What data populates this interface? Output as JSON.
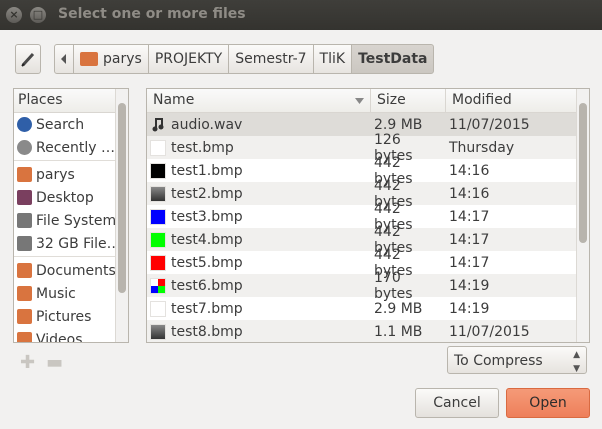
{
  "window": {
    "title": "Select one or more files"
  },
  "breadcrumbs": [
    "parys",
    "PROJEKTY",
    "Semestr-7",
    "TliK",
    "TestData"
  ],
  "places": {
    "header": "Places",
    "items": [
      {
        "label": "Search",
        "icon": "search-icon"
      },
      {
        "label": "Recently …",
        "icon": "recent-icon"
      },
      {
        "label": "parys",
        "icon": "home-folder-icon"
      },
      {
        "label": "Desktop",
        "icon": "desktop-icon"
      },
      {
        "label": "File System",
        "icon": "drive-icon"
      },
      {
        "label": "32 GB File…",
        "icon": "drive-icon"
      },
      {
        "label": "Documents",
        "icon": "folder-icon"
      },
      {
        "label": "Music",
        "icon": "music-folder-icon"
      },
      {
        "label": "Pictures",
        "icon": "pictures-folder-icon"
      },
      {
        "label": "Videos",
        "icon": "videos-folder-icon"
      }
    ]
  },
  "files": {
    "columns": [
      "Name",
      "Size",
      "Modified"
    ],
    "rows": [
      {
        "name": "audio.wav",
        "size": "2.9 MB",
        "modified": "11/07/2015",
        "icon": "audio-icon",
        "color": ""
      },
      {
        "name": "test.bmp",
        "size": "126 bytes",
        "modified": "Thursday",
        "icon": "image-thumb",
        "color": "#ffffff"
      },
      {
        "name": "test1.bmp",
        "size": "442 bytes",
        "modified": "14:16",
        "icon": "image-thumb",
        "color": "#000000"
      },
      {
        "name": "test2.bmp",
        "size": "442 bytes",
        "modified": "14:16",
        "icon": "image-thumb",
        "color": "#555555"
      },
      {
        "name": "test3.bmp",
        "size": "442 bytes",
        "modified": "14:17",
        "icon": "image-thumb",
        "color": "#0000ff"
      },
      {
        "name": "test4.bmp",
        "size": "442 bytes",
        "modified": "14:17",
        "icon": "image-thumb",
        "color": "#00ff00"
      },
      {
        "name": "test5.bmp",
        "size": "442 bytes",
        "modified": "14:17",
        "icon": "image-thumb",
        "color": "#ff0000"
      },
      {
        "name": "test6.bmp",
        "size": "170 bytes",
        "modified": "14:19",
        "icon": "image-thumb",
        "color": "multi"
      },
      {
        "name": "test7.bmp",
        "size": "2.9 MB",
        "modified": "14:19",
        "icon": "image-thumb",
        "color": "#ffffff"
      },
      {
        "name": "test8.bmp",
        "size": "1.1 MB",
        "modified": "11/07/2015",
        "icon": "image-thumb",
        "color": "#555555"
      }
    ]
  },
  "filter": {
    "value": "To Compress"
  },
  "buttons": {
    "cancel": "Cancel",
    "open": "Open"
  }
}
